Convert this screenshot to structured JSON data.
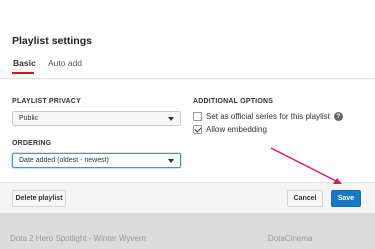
{
  "dialog": {
    "title": "Playlist settings",
    "tabs": [
      {
        "label": "Basic",
        "active": true
      },
      {
        "label": "Auto add",
        "active": false
      }
    ]
  },
  "privacy": {
    "label": "PLAYLIST PRIVACY",
    "value": "Public"
  },
  "ordering": {
    "label": "ORDERING",
    "value": "Date added (oldest - newest)"
  },
  "additional": {
    "label": "ADDITIONAL OPTIONS",
    "options": [
      {
        "label": "Set as official series for this playlist",
        "checked": false,
        "help": "?"
      },
      {
        "label": "Allow embedding",
        "checked": true
      }
    ]
  },
  "footer": {
    "delete_label": "Delete playlist",
    "cancel_label": "Cancel",
    "save_label": "Save"
  },
  "background": {
    "video_title": "Dota 2 Hero Spotlight - Winter Wyvern",
    "channel": "DotaCinema"
  },
  "colors": {
    "accent_red": "#cc181e",
    "primary_blue": "#167ac6",
    "annotation": "#d81b60"
  }
}
